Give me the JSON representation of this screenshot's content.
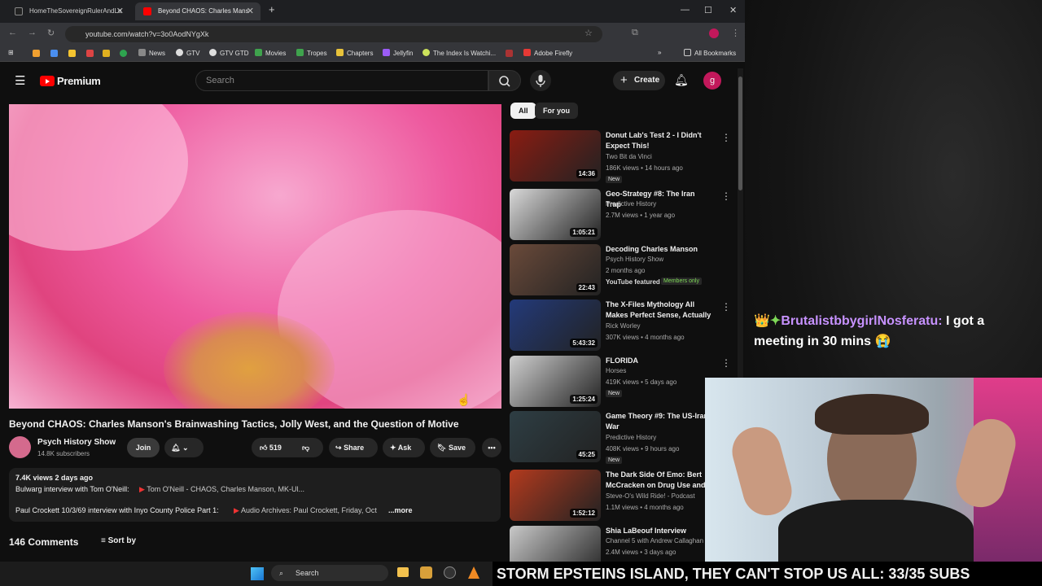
{
  "tabs": [
    {
      "label": "HomeTheSovereignRulerAndLe"
    },
    {
      "label": "Beyond CHAOS: Charles Mans"
    }
  ],
  "address": {
    "url": "youtube.com/watch?v=3o0AodNYgXk"
  },
  "bookmarks": [
    {
      "label": "News"
    },
    {
      "label": "GTV"
    },
    {
      "label": "GTV GTD"
    },
    {
      "label": "Movies"
    },
    {
      "label": "Tropes"
    },
    {
      "label": "Chapters"
    },
    {
      "label": "Jellyfin"
    },
    {
      "label": "The Index Is Watchi..."
    },
    {
      "label": "Adobe Firefly"
    },
    {
      "label": "All Bookmarks"
    }
  ],
  "yt": {
    "logo": "Premium",
    "search_placeholder": "Search",
    "create": "Create",
    "avatar": "g",
    "chips": [
      "All",
      "For you"
    ]
  },
  "video": {
    "title": "Beyond CHAOS: Charles Manson's Brainwashing Tactics, Jolly West, and the Question of Motive",
    "channel": "Psych History Show",
    "subs": "14.8K subscribers",
    "join": "Join",
    "likes": "519",
    "share": "Share",
    "ask": "Ask",
    "save": "Save",
    "stats": "7.4K views  2 days ago",
    "desc_line1": "Bulwarg interview with Tom O'Neill:",
    "desc_link1": "Tom O'Neill - CHAOS, Charles Manson, MK-Ul...",
    "desc_line2": "Paul Crockett 10/3/69 interview with Inyo County Police Part 1:",
    "desc_link2": "Audio Archives: Paul Crockett, Friday, Oct",
    "more": "...more",
    "comments": "146 Comments",
    "sort": "Sort by"
  },
  "recs": [
    {
      "title": "Donut Lab's Test 2 - I Didn't Expect This!",
      "channel": "Two Bit da Vinci",
      "meta": "186K views • 14 hours ago",
      "badge": "New",
      "duration": "14:36",
      "thumb_color": "#8a1c12"
    },
    {
      "title": "Geo-Strategy #8: The Iran Trap",
      "channel": "Predictive History",
      "meta": "2.7M views • 1 year ago",
      "badge": "",
      "duration": "1:05:21",
      "thumb_color": "#d9d9d9"
    },
    {
      "title": "Decoding Charles Manson",
      "channel": "Psych History Show",
      "meta": "2 months ago",
      "badge": "",
      "duration": "22:43",
      "thumb_color": "#6a4a3a",
      "featured": "YouTube featured",
      "members": "Members only"
    },
    {
      "title": "The X-Files Mythology All Makes Perfect Sense, Actually",
      "channel": "Rick Worley",
      "meta": "307K views • 4 months ago",
      "badge": "",
      "duration": "5:43:32",
      "thumb_color": "#233a7a"
    },
    {
      "title": "FLORIDA",
      "channel": "Horses",
      "meta": "419K views • 5 days ago",
      "badge": "New",
      "duration": "1:25:24",
      "thumb_color": "#cfcfcf"
    },
    {
      "title": "Game Theory #9: The US-Iran War",
      "channel": "Predictive History",
      "meta": "408K views • 9 hours ago",
      "badge": "New",
      "duration": "45:25",
      "thumb_color": "#2e3e44"
    },
    {
      "title": "The Dark Side Of Emo: Bert McCracken on Drug Use and",
      "channel": "Steve-O's Wild Ride! - Podcast",
      "meta": "1.1M views • 4 months ago",
      "badge": "",
      "duration": "1:52:12",
      "thumb_color": "#b33a1e"
    },
    {
      "title": "Shia LaBeouf Interview",
      "channel": "Channel 5 with Andrew Callaghan",
      "meta": "2.4M views • 3 days ago",
      "badge": "",
      "duration": "",
      "thumb_color": "#c9c9c9"
    }
  ],
  "chat": {
    "name": "BrutalistbbygirlNosferatu:",
    "message": "I got a meeting in 30 mins 😭"
  },
  "ticker": "STORM EPSTEINS ISLAND, THEY CAN'T STOP US ALL: 33/35 SUBS",
  "taskbar": {
    "search": "Search"
  }
}
